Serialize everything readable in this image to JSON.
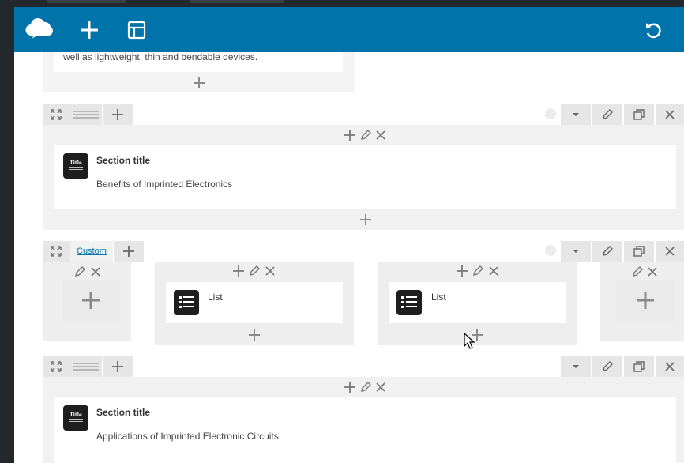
{
  "topbar": {
    "icons": [
      "logo-cloud-icon",
      "add-icon",
      "layout-icon",
      "undo-icon"
    ]
  },
  "section_intro": {
    "text_tail": "well as lightweight, thin and bendable devices."
  },
  "row1": {
    "element_title": "Section title",
    "element_text": "Benefits of Imprinted Electronics"
  },
  "row2": {
    "custom_label": "Custom",
    "list1_title": "List",
    "list2_title": "List"
  },
  "row3": {
    "element_title": "Section title",
    "element_text": "Applications of Imprinted Electronic Circuits"
  },
  "thumb_label": "Title",
  "colors": {
    "topbar": "#0073aa",
    "admin_dark": "#23282d",
    "row_bg": "#f1f1f1",
    "tool_bg": "#e6e6e6",
    "link": "#0073aa"
  }
}
